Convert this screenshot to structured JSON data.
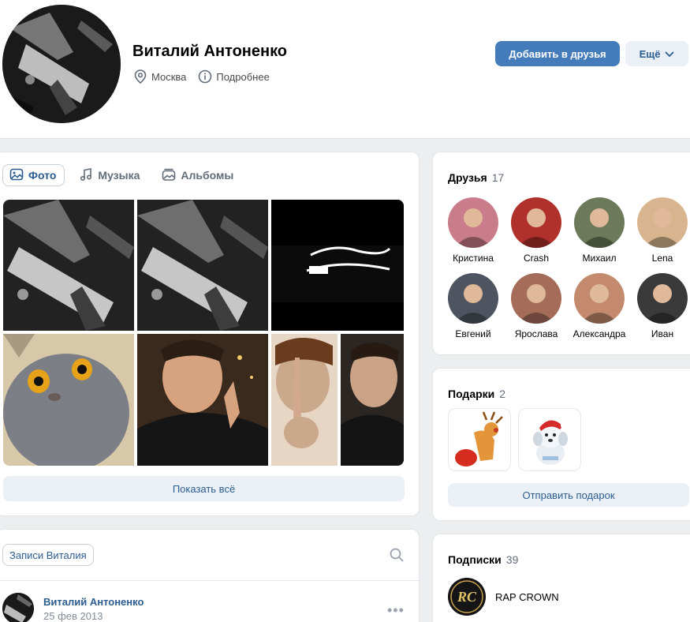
{
  "profile": {
    "name": "Виталий Антоненко",
    "city": "Москва",
    "details_label": "Подробнее",
    "add_friend_label": "Добавить в друзья",
    "more_label": "Ещё"
  },
  "photos": {
    "tabs": [
      {
        "label": "Фото",
        "icon": "image-icon",
        "active": true
      },
      {
        "label": "Музыка",
        "icon": "music-note-icon",
        "active": false
      },
      {
        "label": "Альбомы",
        "icon": "albums-icon",
        "active": false
      }
    ],
    "logo_text": "Прав... Бешеда",
    "show_all_label": "Показать всё"
  },
  "wall": {
    "tab_label": "Записи Виталия",
    "post": {
      "author": "Виталий Антоненко",
      "date": "25 фев 2013"
    }
  },
  "friends": {
    "title": "Друзья",
    "count": "17",
    "items": [
      {
        "name": "Кристина",
        "color": "#c97c8a"
      },
      {
        "name": "Crash",
        "color": "#b0302c"
      },
      {
        "name": "Михаил",
        "color": "#6c7a5a"
      },
      {
        "name": "Lena",
        "color": "#d8b58e"
      },
      {
        "name": "Евгений",
        "color": "#4e5560"
      },
      {
        "name": "Ярослава",
        "color": "#a66c5a"
      },
      {
        "name": "Александра",
        "color": "#c48a6e"
      },
      {
        "name": "Иван",
        "color": "#3a3a3a"
      }
    ]
  },
  "gifts": {
    "title": "Подарки",
    "count": "2",
    "send_label": "Отправить подарок"
  },
  "subscriptions": {
    "title": "Подписки",
    "count": "39",
    "items": [
      {
        "name": "RAP CROWN",
        "logo_text": "RC"
      }
    ]
  },
  "colors": {
    "accent": "#447bba",
    "link": "#2c5d91",
    "secondary_bg": "#eaf0f6",
    "page_bg": "#edeef0"
  }
}
